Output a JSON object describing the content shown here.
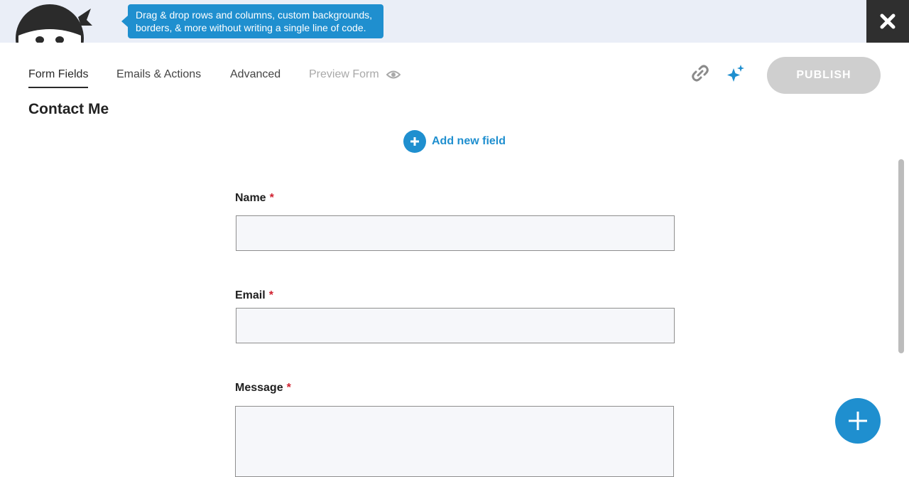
{
  "banner": {
    "tooltip_line1": "Drag & drop rows and columns, custom backgrounds,",
    "tooltip_line2": "borders, & more without writing a single line of code."
  },
  "nav": {
    "tabs": [
      {
        "label": "Form Fields",
        "active": true
      },
      {
        "label": "Emails & Actions",
        "active": false
      },
      {
        "label": "Advanced",
        "active": false
      },
      {
        "label": "Preview Form",
        "active": false,
        "disabled": true
      }
    ],
    "publish_label": "PUBLISH"
  },
  "form": {
    "title": "Contact Me",
    "add_field_label": "Add new field",
    "fields": [
      {
        "label": "Name",
        "required_mark": "*",
        "value": ""
      },
      {
        "label": "Email",
        "required_mark": "*",
        "value": ""
      },
      {
        "label": "Message",
        "required_mark": "*",
        "value": ""
      }
    ]
  },
  "icons": {
    "logo": "ninja-logo-icon",
    "close": "close-x-icon",
    "preview": "eye-icon",
    "link": "link-icon",
    "ai": "sparkle-icon",
    "add": "plus-icon"
  },
  "colors": {
    "accent": "#1f8fcf",
    "banner_bg": "#eaeef7",
    "close_bg": "#2f2f2f",
    "publish_disabled": "#cfcfcf",
    "required": "#d0202f"
  }
}
